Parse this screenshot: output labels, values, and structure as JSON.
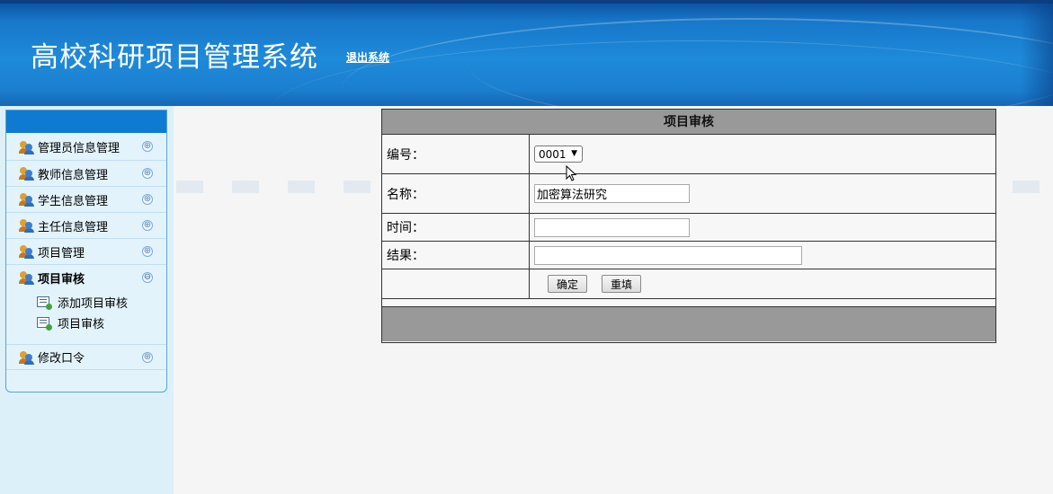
{
  "header": {
    "title": "高校科研项目管理系统",
    "logout_label": "退出系统"
  },
  "sidebar": {
    "items": [
      {
        "label": "管理员信息管理",
        "icon": "users-icon",
        "toggle": "⊕"
      },
      {
        "label": "教师信息管理",
        "icon": "users-icon",
        "toggle": "⊕"
      },
      {
        "label": "学生信息管理",
        "icon": "users-icon",
        "toggle": "⊕"
      },
      {
        "label": "主任信息管理",
        "icon": "users-icon",
        "toggle": "⊕"
      },
      {
        "label": "项目管理",
        "icon": "users-icon",
        "toggle": "⊕"
      },
      {
        "label": "项目审核",
        "icon": "users-icon",
        "toggle": "⊖",
        "expanded": true
      },
      {
        "label": "修改口令",
        "icon": "users-icon",
        "toggle": "⊕"
      }
    ],
    "subitems": [
      {
        "label": "添加项目审核",
        "icon": "document-add-icon"
      },
      {
        "label": "项目审核",
        "icon": "document-add-icon"
      }
    ]
  },
  "form": {
    "caption": "项目审核",
    "fields": {
      "number": {
        "label": "编号：",
        "value": "0001"
      },
      "name": {
        "label": "名称：",
        "value": "加密算法研究"
      },
      "time": {
        "label": "时间：",
        "value": ""
      },
      "result": {
        "label": "结果：",
        "value": ""
      }
    },
    "buttons": {
      "confirm": "确定",
      "reset": "重填"
    }
  },
  "colors": {
    "header_blue": "#1e8ad9",
    "sidebar_head": "#0f7ad2",
    "table_caption_bg": "#999999"
  }
}
